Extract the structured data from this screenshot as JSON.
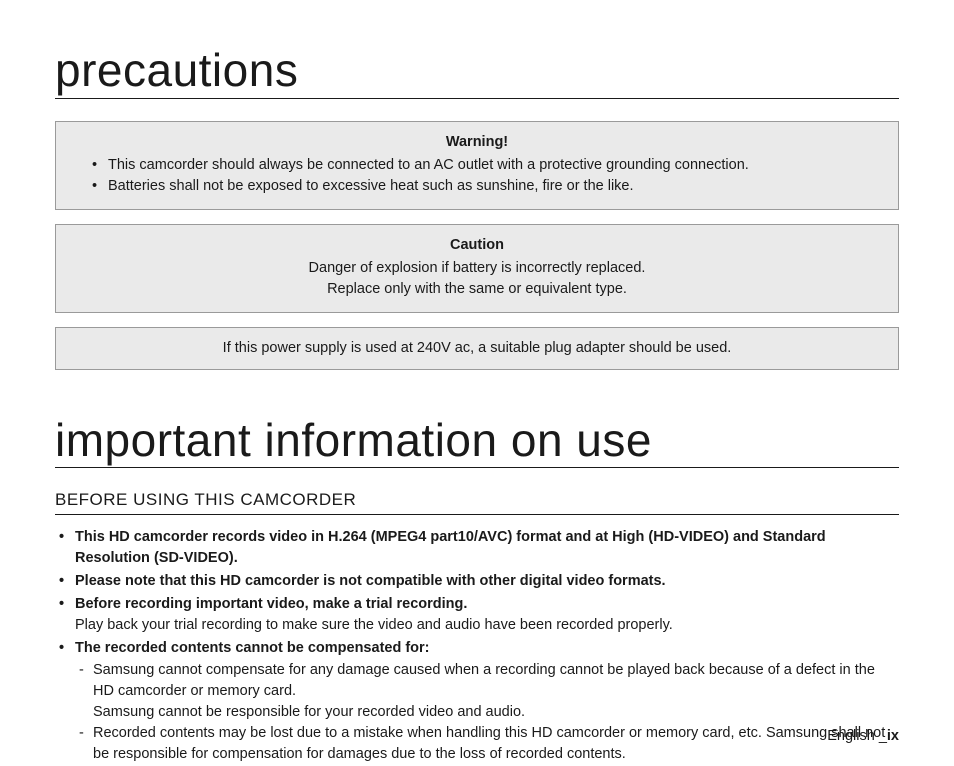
{
  "heading1": "precautions",
  "warningBox": {
    "title": "Warning!",
    "items": [
      "This camcorder should always be connected to an AC outlet with a protective grounding connection.",
      "Batteries shall not be exposed to excessive heat such as sunshine, fire or the like."
    ]
  },
  "cautionBox": {
    "title": "Caution",
    "lines": [
      "Danger of explosion if battery is incorrectly replaced.",
      "Replace only with the same or equivalent type."
    ]
  },
  "noteBox": {
    "text": "If this power supply is used at 240V ac, a suitable plug adapter should be used."
  },
  "heading2": "important information on use",
  "subheading": "BEFORE USING THIS CAMCORDER",
  "bullets": {
    "b1": "This HD camcorder records video in H.264 (MPEG4 part10/AVC) format and at High (HD-VIDEO) and Standard Resolution (SD-VIDEO).",
    "b2": "Please note that this HD camcorder is not compatible with other digital video formats.",
    "b3_bold": "Before recording important video, make a trial recording.",
    "b3_text": "Play back your trial recording to make sure the video and audio have been recorded properly.",
    "b4_bold": "The recorded contents cannot be compensated for:",
    "b4_sub1_a": "Samsung cannot compensate for any damage caused when a recording cannot be played back because of a defect in the HD camcorder or memory card.",
    "b4_sub1_b": "Samsung cannot be responsible for your recorded video and audio.",
    "b4_sub2": "Recorded contents may be lost due to a mistake when handling this HD camcorder or memory card, etc. Samsung shall not be responsible for compensation for damages due to the loss of recorded contents."
  },
  "footer": {
    "lang": "English _",
    "page": "ix"
  }
}
